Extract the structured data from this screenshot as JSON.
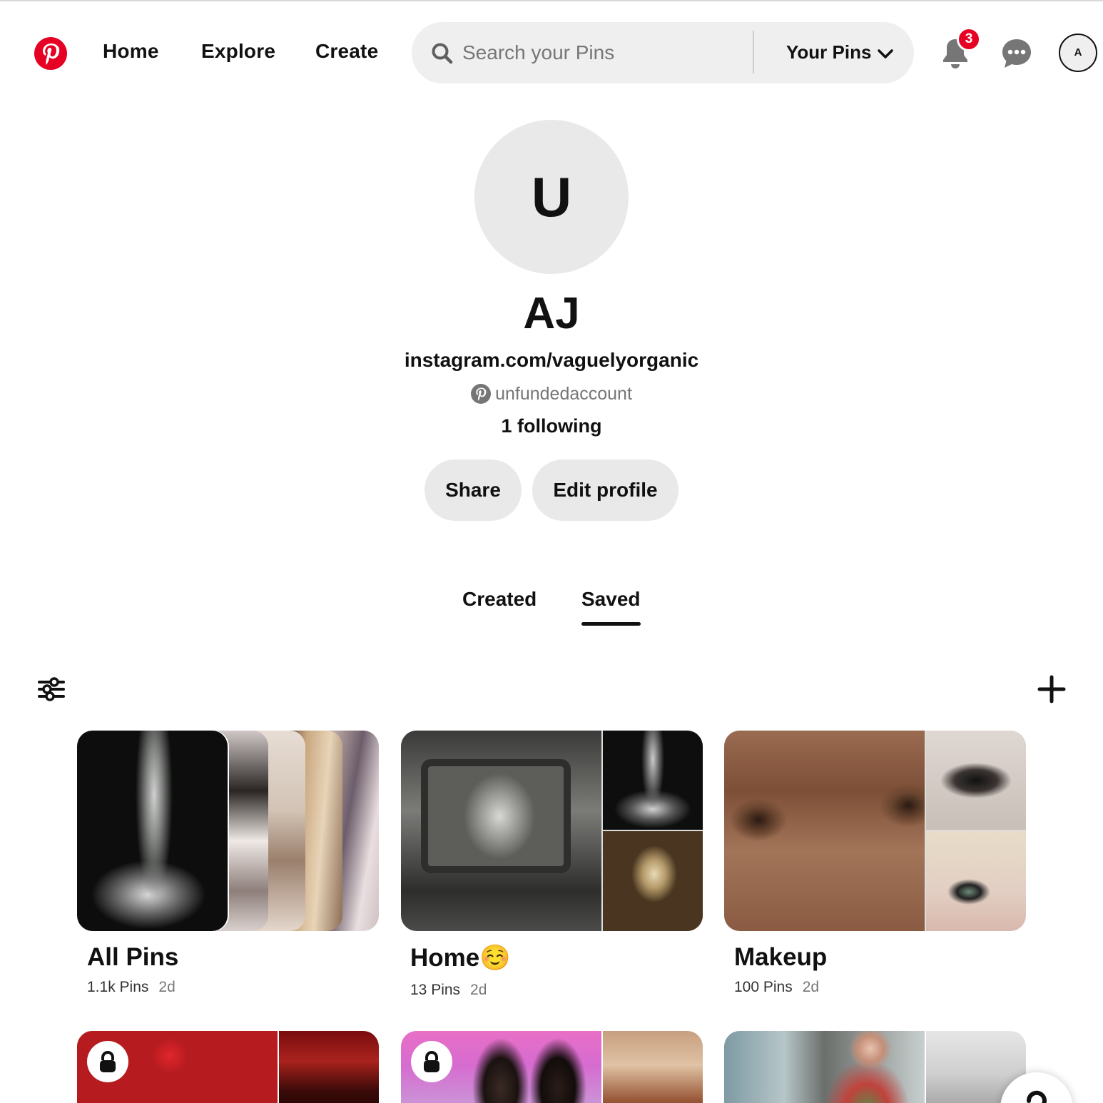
{
  "brand": {
    "accent": "#e60023"
  },
  "nav": {
    "home": "Home",
    "explore": "Explore",
    "create": "Create"
  },
  "search": {
    "placeholder": "Search your Pins",
    "scope": "Your Pins"
  },
  "notifications": {
    "count": "3"
  },
  "account": {
    "initial": "A"
  },
  "profile": {
    "initial": "U",
    "name": "AJ",
    "website": "instagram.com/vaguelyorganic",
    "username": "unfundedaccount",
    "following": "1 following",
    "share_label": "Share",
    "edit_label": "Edit profile"
  },
  "tabs": {
    "created": "Created",
    "saved": "Saved",
    "active": "Saved"
  },
  "boards": [
    {
      "title": "All Pins",
      "pins": "1.1k Pins",
      "age": "2d"
    },
    {
      "title": "Home☺️",
      "pins": "13 Pins",
      "age": "2d"
    },
    {
      "title": "Makeup",
      "pins": "100 Pins",
      "age": "2d"
    }
  ],
  "icons": {
    "logo": "pinterest-logo",
    "search": "search-icon",
    "scope": "chevron-down-icon",
    "notifications": "bell-icon",
    "messages": "chat-icon",
    "filter": "filter-icon",
    "add": "plus-icon",
    "private": "lock-icon"
  }
}
